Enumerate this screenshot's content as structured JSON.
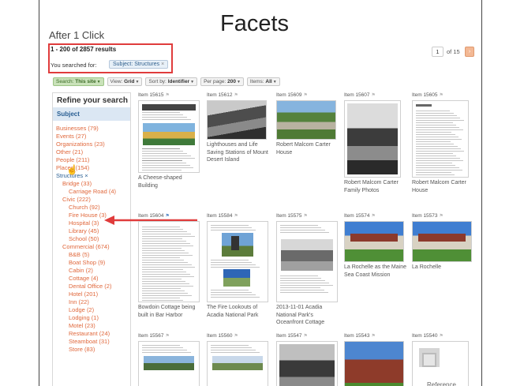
{
  "slide": {
    "title": "Facets",
    "subtitle": "After 1 Click"
  },
  "results": {
    "count_text": "1 - 200 of 2857 results",
    "searched_label": "You searched for:",
    "chip": "Subject: Structures",
    "chip_close": "×"
  },
  "pager": {
    "page": "1",
    "of": "of 15",
    "next": "›"
  },
  "toolbar": {
    "search_label": "Search:",
    "search_value": "This site",
    "view_label": "View:",
    "view_value": "Grid",
    "sort_label": "Sort by:",
    "sort_value": "Identifier",
    "perpage_label": "Per page:",
    "perpage_value": "200",
    "items_label": "Items:",
    "items_value": "All"
  },
  "sidebar": {
    "heading": "Refine your search",
    "subject": "Subject",
    "facets": [
      {
        "label": "Businesses (79)",
        "indent": 0,
        "color": "orange"
      },
      {
        "label": "Events (27)",
        "indent": 0,
        "color": "orange"
      },
      {
        "label": "Organizations (23)",
        "indent": 0,
        "color": "orange"
      },
      {
        "label": "Other (21)",
        "indent": 0,
        "color": "orange"
      },
      {
        "label": "People (211)",
        "indent": 0,
        "color": "orange"
      },
      {
        "label": "Places (154)",
        "indent": 0,
        "color": "orange"
      },
      {
        "label": "Structures ×",
        "indent": 0,
        "color": "blue"
      },
      {
        "label": "Bridge (33)",
        "indent": 1,
        "color": "orange"
      },
      {
        "label": "Carriage Road (4)",
        "indent": 2,
        "color": "orange"
      },
      {
        "label": "Civic (222)",
        "indent": 1,
        "color": "orange"
      },
      {
        "label": "Church (92)",
        "indent": 2,
        "color": "orange"
      },
      {
        "label": "Fire House (3)",
        "indent": 2,
        "color": "orange"
      },
      {
        "label": "Hospital (3)",
        "indent": 2,
        "color": "orange"
      },
      {
        "label": "Library (45)",
        "indent": 2,
        "color": "orange"
      },
      {
        "label": "School (50)",
        "indent": 2,
        "color": "orange"
      },
      {
        "label": "Commercial (674)",
        "indent": 1,
        "color": "orange"
      },
      {
        "label": "B&B (5)",
        "indent": 2,
        "color": "orange"
      },
      {
        "label": "Boat Shop (9)",
        "indent": 2,
        "color": "orange"
      },
      {
        "label": "Cabin (2)",
        "indent": 2,
        "color": "orange"
      },
      {
        "label": "Cottage (4)",
        "indent": 2,
        "color": "orange"
      },
      {
        "label": "Dental Office (2)",
        "indent": 2,
        "color": "orange"
      },
      {
        "label": "Hotel (201)",
        "indent": 2,
        "color": "orange"
      },
      {
        "label": "Inn (22)",
        "indent": 2,
        "color": "orange"
      },
      {
        "label": "Lodge (2)",
        "indent": 2,
        "color": "orange"
      },
      {
        "label": "Lodging (1)",
        "indent": 2,
        "color": "orange"
      },
      {
        "label": "Motel (23)",
        "indent": 2,
        "color": "orange"
      },
      {
        "label": "Restaurant (24)",
        "indent": 2,
        "color": "orange"
      },
      {
        "label": "Steamboat (31)",
        "indent": 2,
        "color": "orange"
      },
      {
        "label": "Store (83)",
        "indent": 2,
        "color": "orange"
      }
    ]
  },
  "items": [
    {
      "id": "Item 15615",
      "caption": "A Cheese-shaped Building",
      "thumb": "doc-photo"
    },
    {
      "id": "Item 15612",
      "caption": "Lighthouses and Life Saving Stations of Mount Desert Island",
      "thumb": "bw-rocks"
    },
    {
      "id": "Item 15609",
      "caption": "Robert Malcom Carter House",
      "thumb": "color-house"
    },
    {
      "id": "Item 15607",
      "caption": "Robert Malcom Carter Family Photos",
      "thumb": "bw-people"
    },
    {
      "id": "Item 15605",
      "caption": "Robert Malcom Carter House",
      "thumb": "letter"
    },
    {
      "id": "Item 15604",
      "caption": "Bowdoin Cottage being built in Bar Harbor",
      "thumb": "text"
    },
    {
      "id": "Item 15584",
      "caption": "The Fire Lookouts of Acadia National Park",
      "thumb": "doc-tower"
    },
    {
      "id": "Item 15575",
      "caption": "2013-11-01 Acadia National Park's Oceanfront Cottage",
      "thumb": "doc-bw"
    },
    {
      "id": "Item 15574",
      "caption": "La Rochelle as the Maine Sea Coast Mission",
      "thumb": "mansion"
    },
    {
      "id": "Item 15573",
      "caption": "La Rochelle",
      "thumb": "mansion"
    },
    {
      "id": "Item 15567",
      "caption": "",
      "thumb": "doc-color"
    },
    {
      "id": "Item 15560",
      "caption": "",
      "thumb": "doc-color2"
    },
    {
      "id": "Item 15547",
      "caption": "",
      "thumb": "bw-street"
    },
    {
      "id": "Item 15543",
      "caption": "",
      "thumb": "brick-house"
    },
    {
      "id": "Item 15540",
      "caption": "",
      "thumb": "reference",
      "ref_label": "Reference"
    }
  ],
  "colors": {
    "accent_red": "#e03c3c",
    "facet_orange": "#e0683c",
    "facet_blue": "#2a5f93"
  }
}
